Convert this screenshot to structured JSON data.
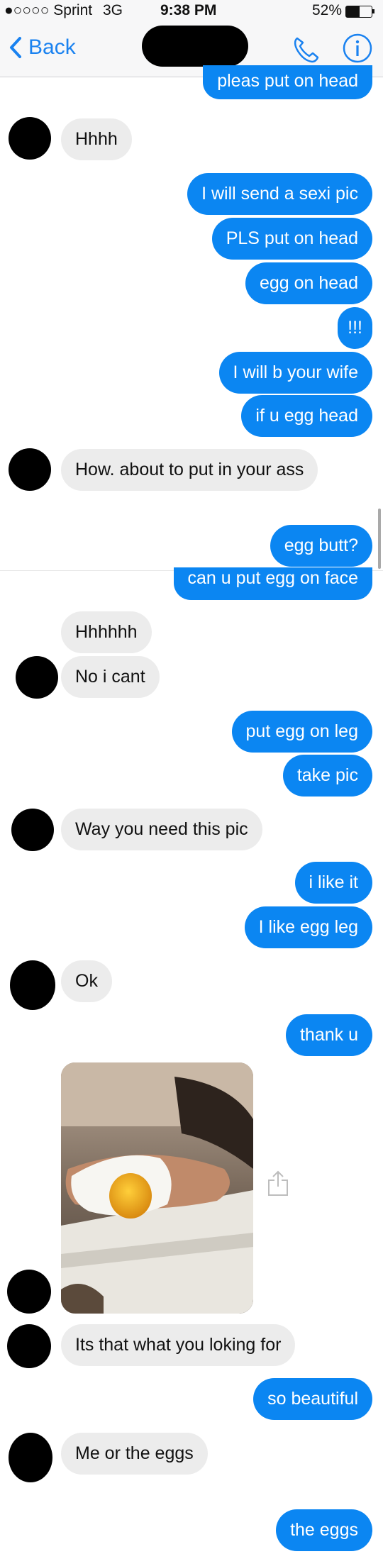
{
  "status": {
    "carrier": "●○○○○ Sprint",
    "network": "3G",
    "time": "9:38 PM",
    "battery": "52%"
  },
  "nav": {
    "back": "Back"
  },
  "messages": [
    "pleas put on head",
    "Hhhh",
    "I will send a sexi pic",
    "PLS put on head",
    "egg on head",
    "!!!",
    "I will b your wife",
    "if u egg head",
    "How. about to put in your ass",
    "egg butt?",
    "can u put egg on face",
    "Hhhhhh",
    "No i cant",
    "put egg on leg",
    "take pic",
    "Way you need this pic",
    "i like it",
    "I like egg leg",
    "Ok",
    "thank u",
    "Its that what you loking for",
    "so beautiful",
    "Me or the eggs",
    "the eggs"
  ],
  "colors": {
    "outgoing": "#0b86f2",
    "incoming": "#ececec",
    "accent": "#1a82f0"
  }
}
